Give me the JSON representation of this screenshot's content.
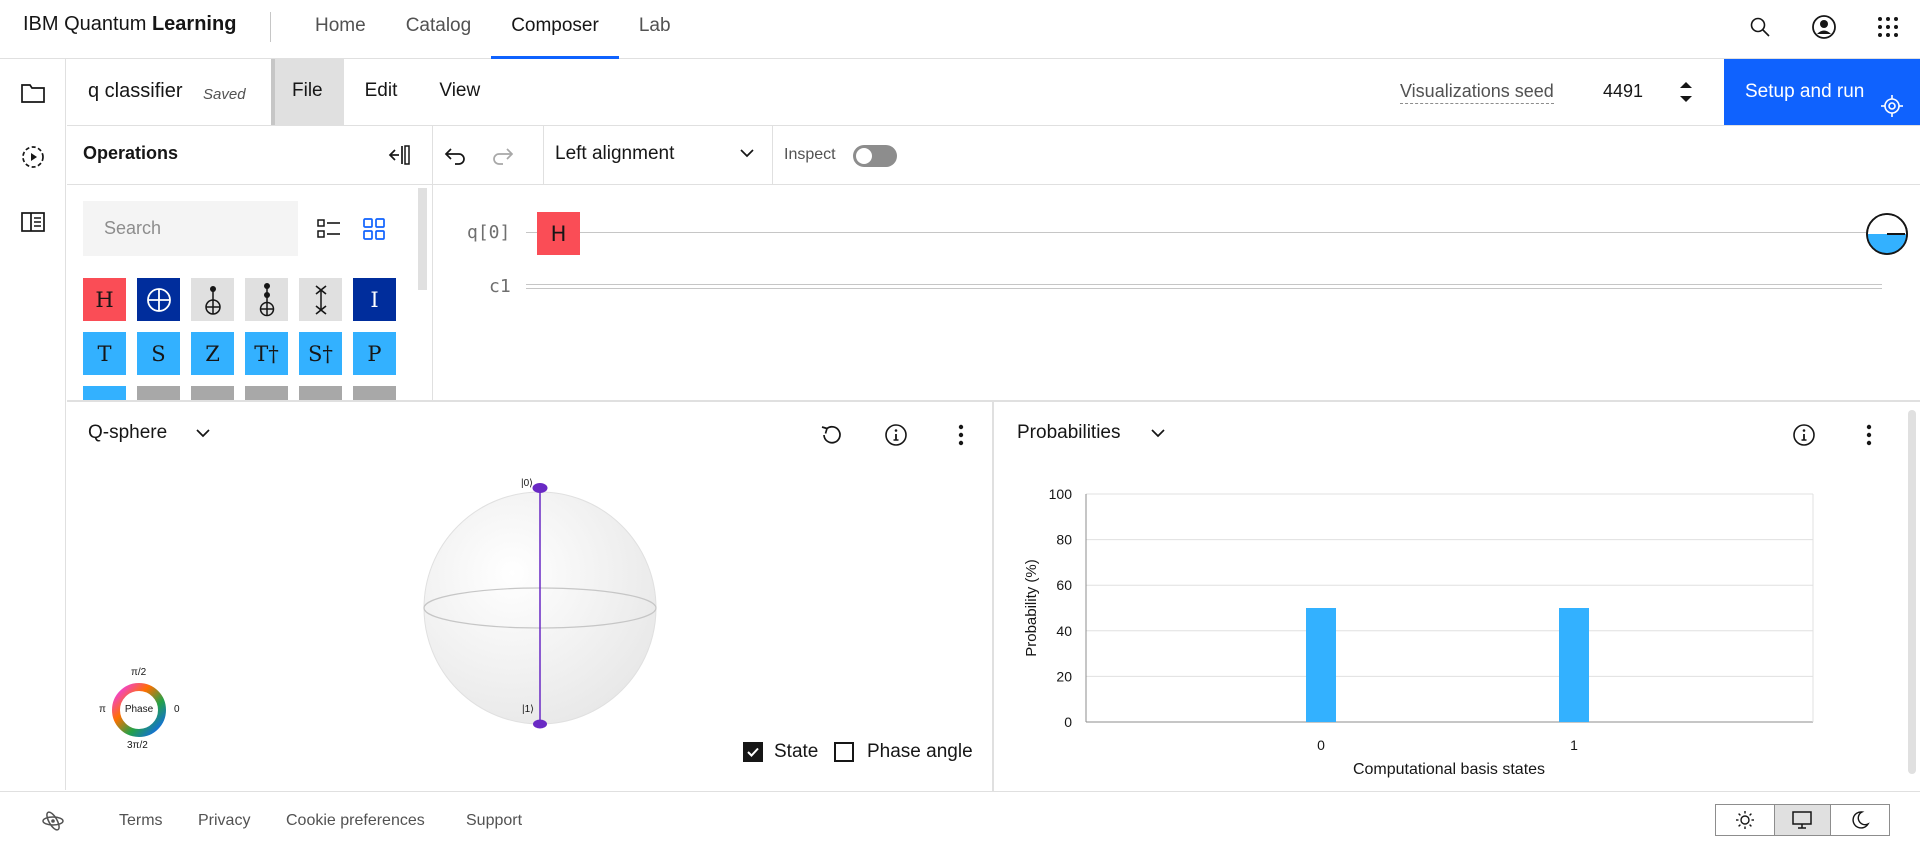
{
  "header": {
    "brand_prefix": "IBM Quantum",
    "brand_bold": "Learning",
    "nav": [
      "Home",
      "Catalog",
      "Composer",
      "Lab"
    ],
    "active_nav": "Composer",
    "icons": [
      "search-icon",
      "user-avatar-icon",
      "app-switcher-icon"
    ]
  },
  "left_rail": {
    "icons": [
      "folder-icon",
      "history-icon",
      "docs-panel-icon"
    ]
  },
  "composer": {
    "title": "q classifier",
    "saved_label": "Saved",
    "menu": [
      "File",
      "Edit",
      "View"
    ],
    "vis_seed_label": "Visualizations seed",
    "seed_value": "4491",
    "setup_label": "Setup and run"
  },
  "operations": {
    "title": "Operations",
    "search_placeholder": "Search",
    "gates_row1": [
      "H",
      "⊕",
      "",
      "",
      "",
      "I"
    ],
    "gates_row2": [
      "T",
      "S",
      "Z",
      "T†",
      "S†",
      "P"
    ]
  },
  "circuit": {
    "alignment": "Left alignment",
    "inspect_label": "Inspect",
    "qubit_label": "q[0]",
    "classical_label": "c1",
    "gate": "H"
  },
  "qsphere": {
    "title": "Q-sphere",
    "ket0": "|0⟩",
    "ket1": "|1⟩",
    "phase_label": "Phase",
    "phase_top": "π/2",
    "phase_left": "π",
    "phase_right": "0",
    "phase_bottom": "3π/2",
    "state_label": "State",
    "phase_angle_label": "Phase angle",
    "state_checked": true,
    "phase_angle_checked": false
  },
  "probabilities": {
    "title": "Probabilities"
  },
  "chart_data": {
    "type": "bar",
    "categories": [
      "0",
      "1"
    ],
    "values": [
      50,
      50
    ],
    "xlabel": "Computational basis states",
    "ylabel": "Probability (%)",
    "ylim": [
      0,
      100
    ],
    "yticks": [
      "0",
      "20",
      "40",
      "60",
      "80",
      "100"
    ],
    "grid": true,
    "bar_color": "#33b1ff"
  },
  "footer": {
    "links": [
      "Terms",
      "Privacy",
      "Cookie preferences",
      "Support"
    ],
    "theme_options": [
      "light-theme-icon",
      "system-theme-icon",
      "dark-theme-icon"
    ]
  },
  "colors": {
    "accent": "#0f62fe",
    "h_gate": "#fa4d56",
    "navy_gate": "#002d9c",
    "cyan_gate": "#33b1ff"
  }
}
